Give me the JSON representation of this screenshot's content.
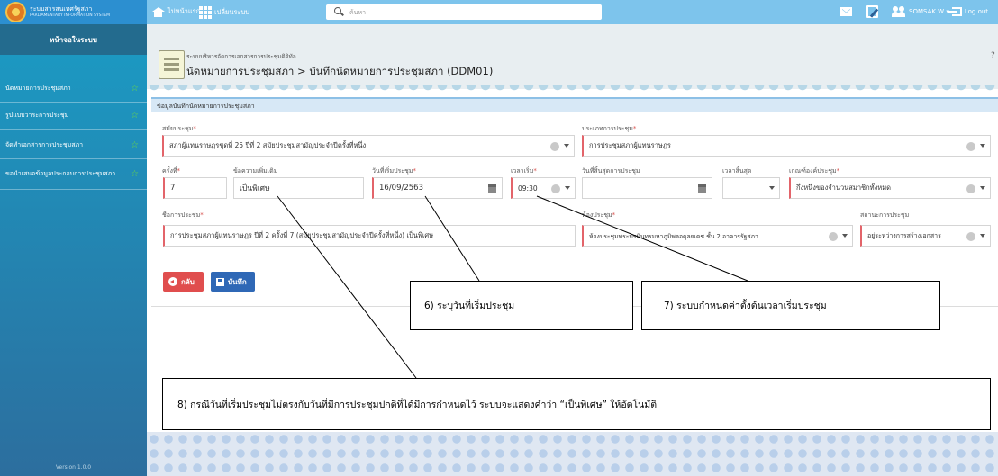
{
  "topbar": {
    "logo_line1": "ระบบสารสนเทศรัฐสภา",
    "logo_line2": "PARLIAMENTARY INFORMATION SYSTEM",
    "home_label": "ไปหน้าแรก",
    "menu_label": "เปลี่ยนระบบ",
    "search_placeholder": "ค้นหา",
    "user_label": "SOMSAK.W ▾",
    "logout_label": "Log out"
  },
  "sidebar": {
    "header": "หน้าจอในระบบ",
    "items": [
      {
        "label": "นัดหมายการประชุมสภา"
      },
      {
        "label": "รูปแบบวาระการประชุม"
      },
      {
        "label": "จัดทำเอกสารการประชุมสภา"
      },
      {
        "label": "ขอนำเสนอข้อมูลประกอบการประชุมสภา"
      }
    ],
    "version": "Version 1.0.0"
  },
  "page": {
    "system_name": "ระบบบริหารจัดการเอกสารการประชุมดิจิทัล",
    "title": "นัดหมายการประชุมสภา > บันทึกนัดหมายการประชุมสภา (DDM01)",
    "corner": "?"
  },
  "form": {
    "panel_title": "ข้อมูลบันทึกนัดหมายการประชุมสภา",
    "session_label": "สมัยประชุม",
    "session_value": "สภาผู้แทนราษฎรชุดที่ 25 ปีที่ 2 สมัยประชุมสามัญประจำปีครั้งที่หนึ่ง",
    "meeting_type_label": "ประเภทการประชุม",
    "meeting_type_value": "การประชุมสภาผู้แทนราษฎร",
    "number_label": "ครั้งที่",
    "number_value": "7",
    "note_label": "ข้อความเพิ่มเติม",
    "note_value": "เป็นพิเศษ",
    "start_date_label": "วันที่เริ่มประชุม",
    "start_date_value": "16/09/2563",
    "start_time_label": "เวลาเริ่ม",
    "start_time_value": "09:30",
    "end_date_label": "วันที่สิ้นสุดการประชุม",
    "end_date_value": "",
    "end_time_label": "เวลาสิ้นสุด",
    "end_time_value": "",
    "quorum_label": "เกณฑ์องค์ประชุม",
    "quorum_value": "กึ่งหนึ่งของจำนวนสมาชิกทั้งหมด",
    "meeting_name_label": "ชื่อการประชุม",
    "meeting_name_value": "การประชุมสภาผู้แทนราษฎร ปีที่ 2 ครั้งที่ 7 (สมัยประชุมสามัญประจำปีครั้งที่หนึ่ง) เป็นพิเศษ",
    "room_label": "ห้องประชุม",
    "room_value": "ห้องประชุมพระปรมินทรมหาภูมิพลอดุลยเดช ชั้น 2 อาคารรัฐสภา",
    "status_label": "สถานะการประชุม",
    "status_value": "อยู่ระหว่างการสร้างเอกสาร",
    "back_label": "กลับ",
    "save_label": "บันทึก"
  },
  "callouts": {
    "c6": "6) ระบุวันที่เริ่มประชุม",
    "c7": "7) ระบบกำหนดค่าตั้งต้นเวลาเริ่มประชุม",
    "c8": "8) กรณีวันที่เริ่มประชุมไม่ตรงกับวันที่มีการประชุมปกติที่ได้มีการกำหนดไว้ ระบบจะแสดงคำว่า “เป็นพิเศษ” ให้อัตโนมัติ"
  },
  "colors": {
    "topbar": "#7dc4ec",
    "sidebar": "#1b9bc4",
    "required_border": "#e3646a",
    "back_button": "#e04e4e",
    "save_button": "#2f68b6"
  }
}
